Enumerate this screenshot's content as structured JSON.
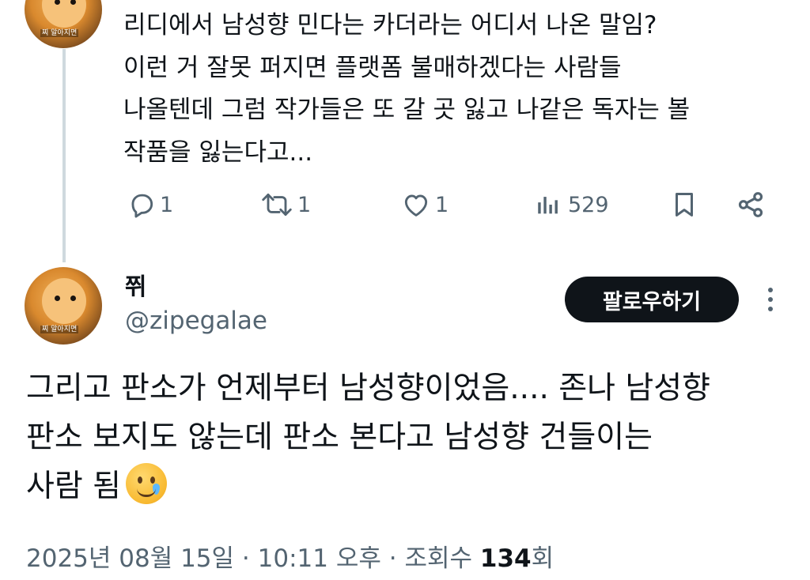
{
  "previous_tweet": {
    "lines": [
      "리디에서 남성향 민다는 카더라는 어디서 나온 말임?",
      "이런 거 잘못 퍼지면 플랫폼 불매하겠다는 사람들",
      "나올텐데 그럼 작가들은 또 갈 곳 잃고 나같은 독자는 볼",
      "작품을 잃는다고..."
    ],
    "avatar_caption": "찌 알아지면",
    "actions": {
      "reply_count": "1",
      "retweet_count": "1",
      "like_count": "1",
      "view_count": "529"
    }
  },
  "tweet": {
    "display_name": "쮜",
    "handle": "@zipegalae",
    "avatar_caption": "찌 알아지면",
    "follow_label": "팔로우하기",
    "text_lines": [
      "그리고 판소가 언제부터 남성향이었음.... 존나 남성향",
      "판소 보지도 않는데 판소 본다고 남성향 건들이는",
      "사람 됨"
    ],
    "emoji": "face-holding-back-tears",
    "date": "2025년 08월 15일",
    "time": "10:11 오후",
    "sep": "·",
    "views_label": "조회수",
    "views_count": "134",
    "views_suffix": "회"
  },
  "colors": {
    "text": "#0f1419",
    "muted": "#536471",
    "follow_bg": "#0f1419",
    "thread_line": "#cfd9de"
  }
}
